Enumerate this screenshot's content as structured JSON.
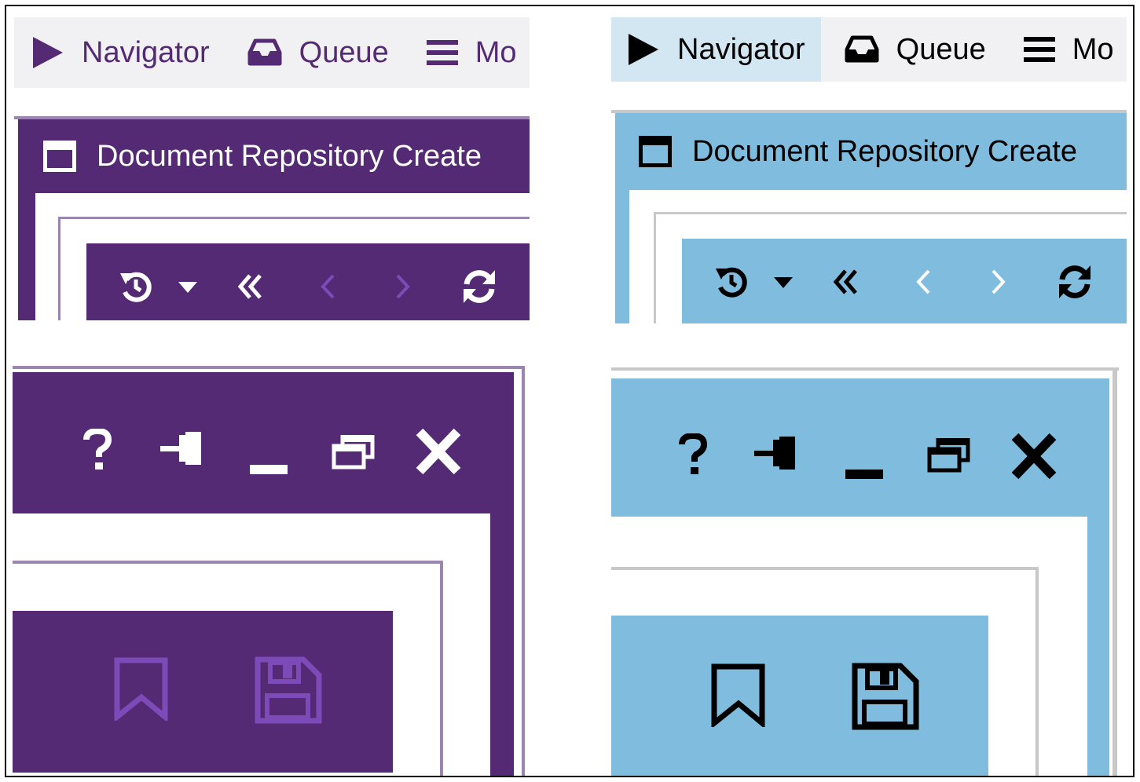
{
  "colors": {
    "purple_theme": {
      "accent": "#532a73",
      "navbar_bg": "#f1f1f3",
      "text": "#532a73",
      "icon_on_bar": "#ffffff",
      "disabled_icon": "#7d4bb8",
      "border_light": "#9a86b1"
    },
    "blue_theme": {
      "accent": "#80bcde",
      "navbar_bg": "#f1f1f3",
      "active_tab_bg": "#d3e7f3",
      "text": "#000000",
      "icon_on_bar": "#000000",
      "disabled_icon": "#ffffff",
      "border_light": "#c8c8c8"
    }
  },
  "purple_theme": {
    "navbar": {
      "items": [
        {
          "icon": "play-icon",
          "label": "Navigator"
        },
        {
          "icon": "inbox-icon",
          "label": "Queue"
        },
        {
          "icon": "menu-icon",
          "label": "Mo"
        }
      ]
    },
    "window_title": {
      "icon": "window-icon",
      "label": "Document Repository Create"
    },
    "toolbar": {
      "icons": [
        "history-icon",
        "caret-down-icon",
        "double-chevron-left-icon",
        "chevron-left-icon",
        "chevron-right-icon",
        "refresh-icon"
      ]
    },
    "window_controls": {
      "icons": [
        "help-icon",
        "pin-icon",
        "minimize-icon",
        "restore-icon",
        "close-icon"
      ]
    },
    "actions": {
      "icons": [
        "bookmark-icon",
        "save-icon"
      ],
      "state": "disabled"
    }
  },
  "blue_theme": {
    "navbar": {
      "items": [
        {
          "icon": "play-icon",
          "label": "Navigator",
          "active": true
        },
        {
          "icon": "inbox-icon",
          "label": "Queue"
        },
        {
          "icon": "menu-icon",
          "label": "Mo"
        }
      ]
    },
    "window_title": {
      "icon": "window-icon",
      "label": "Document Repository Create"
    },
    "toolbar": {
      "icons": [
        "history-icon",
        "caret-down-icon",
        "double-chevron-left-icon",
        "chevron-left-icon",
        "chevron-right-icon",
        "refresh-icon"
      ]
    },
    "window_controls": {
      "icons": [
        "help-icon",
        "pin-icon",
        "minimize-icon",
        "restore-icon",
        "close-icon"
      ]
    },
    "actions": {
      "icons": [
        "bookmark-icon",
        "save-icon"
      ],
      "state": "enabled"
    }
  }
}
